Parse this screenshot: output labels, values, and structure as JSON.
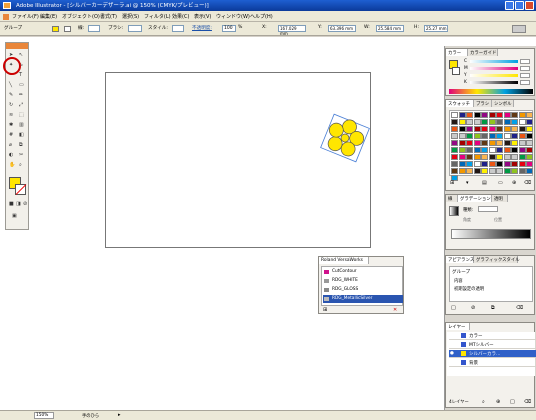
{
  "window": {
    "title": "Adobe Illustrator - [シルバーカーデザーラ.ai @ 150% (CMYK/プレビュー)]"
  },
  "menu": {
    "items": [
      "ファイル(F)",
      "編集(E)",
      "オブジェクト(O)",
      "書式(T)",
      "選択(S)",
      "フィルタ(L)",
      "効果(C)",
      "表示(V)",
      "ウィンドウ(W)",
      "ヘルプ(H)"
    ]
  },
  "control": {
    "group_label": "グループ",
    "stroke_label": "線:",
    "brush_label": "ブラシ:",
    "style_label": "スタイル:",
    "opacity_label": "不透明度:",
    "opacity_value": "100",
    "percent": "%",
    "x_label": "X:",
    "x_value": "167.029 mm",
    "y_label": "Y:",
    "y_value": "63.396 mm",
    "w_label": "W:",
    "w_value": "25.584 mm",
    "h_label": "H:",
    "h_value": "25.27 mm"
  },
  "panels": {
    "color": {
      "tabs": [
        "カラー",
        "カラーガイド"
      ],
      "rows": [
        "C",
        "M",
        "Y",
        "K"
      ]
    },
    "swatches": {
      "tabs": [
        "スウォッチ",
        "ブラシ",
        "シンボル"
      ]
    },
    "gradient": {
      "tabs": [
        "線",
        "グラデーション",
        "透明"
      ],
      "type_label": "種類:",
      "angle_label": "角度",
      "position_label": "位置"
    },
    "appearance": {
      "tabs": [
        "アピアランス",
        "グラフィックスタイル"
      ],
      "group_label": "グループ",
      "contents_label": "内容",
      "opacity_label": "初期設定の透明"
    },
    "layers": {
      "tabs": [
        "レイヤー"
      ],
      "items": [
        "カラー",
        "MTシルバー",
        "シルバーカラ…",
        "背景"
      ],
      "footer": "4レイヤー"
    },
    "pantone": {
      "title": "Roland VersaWorks",
      "items": [
        "CutContour",
        "RDG_WHITE",
        "RDG_GLOSS",
        "RDG_MetallicSilver"
      ]
    }
  },
  "status": {
    "zoom": "150%",
    "tool_name": "手のひら"
  },
  "colors": {
    "accent": "#e9863a",
    "flower_fill": "#ffe600",
    "selection": "#4a7fd6",
    "title_blue": "#0b3a9a",
    "highlight_red": "#cc0000"
  }
}
